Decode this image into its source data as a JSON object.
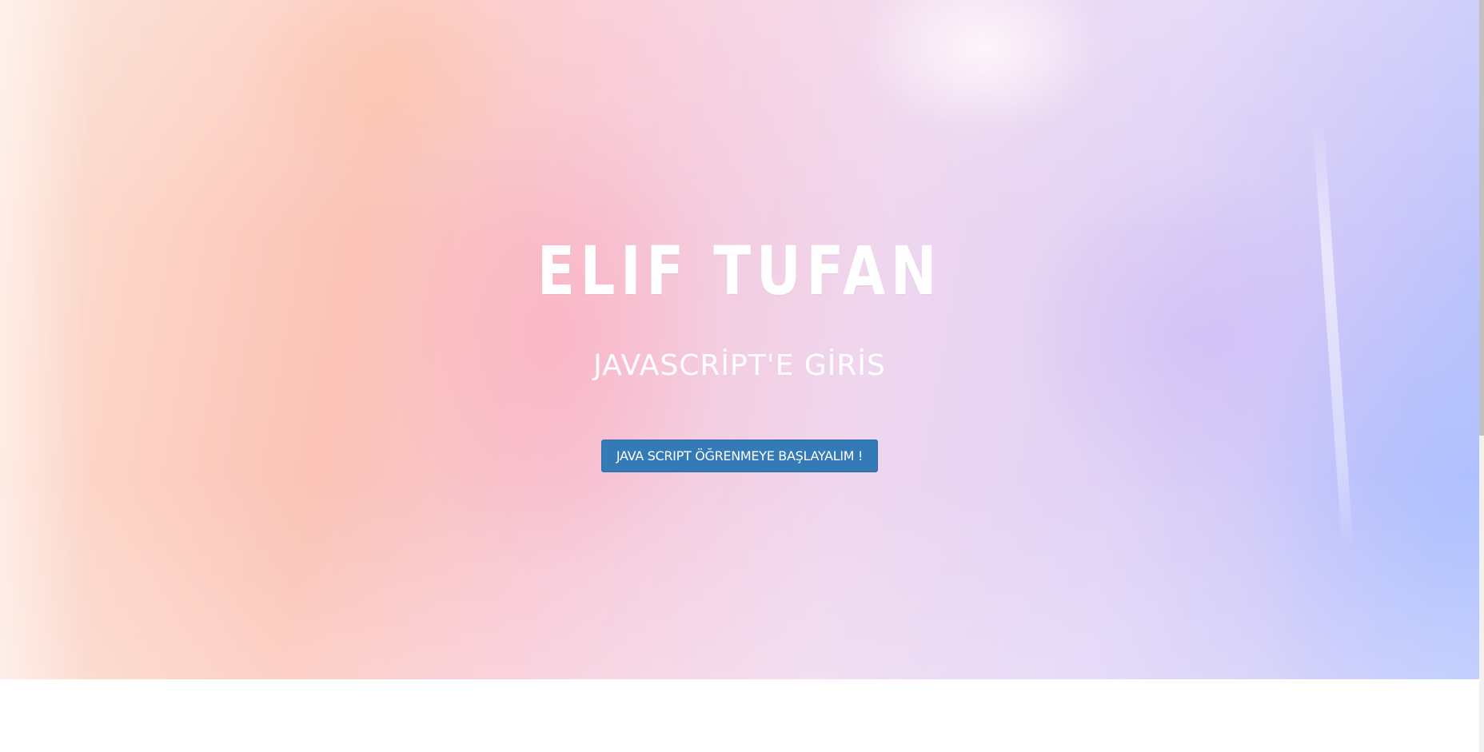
{
  "hero": {
    "title": "ELIF TUFAN",
    "subtitle": "JAVASCRİPT'E GİRİS",
    "button_label": "JAVA SCRIPT ÖĞRENMEYE BAŞLAYALIM !"
  },
  "colors": {
    "button_bg": "#337ab7",
    "button_border": "#2e6da4",
    "text": "#ffffff",
    "background_gradient": [
      "#fde2d5",
      "#fbc3b6",
      "#f8c6d4",
      "#efd6ee",
      "#e0d2f6",
      "#c9c6fa",
      "#b6c4fc"
    ]
  }
}
